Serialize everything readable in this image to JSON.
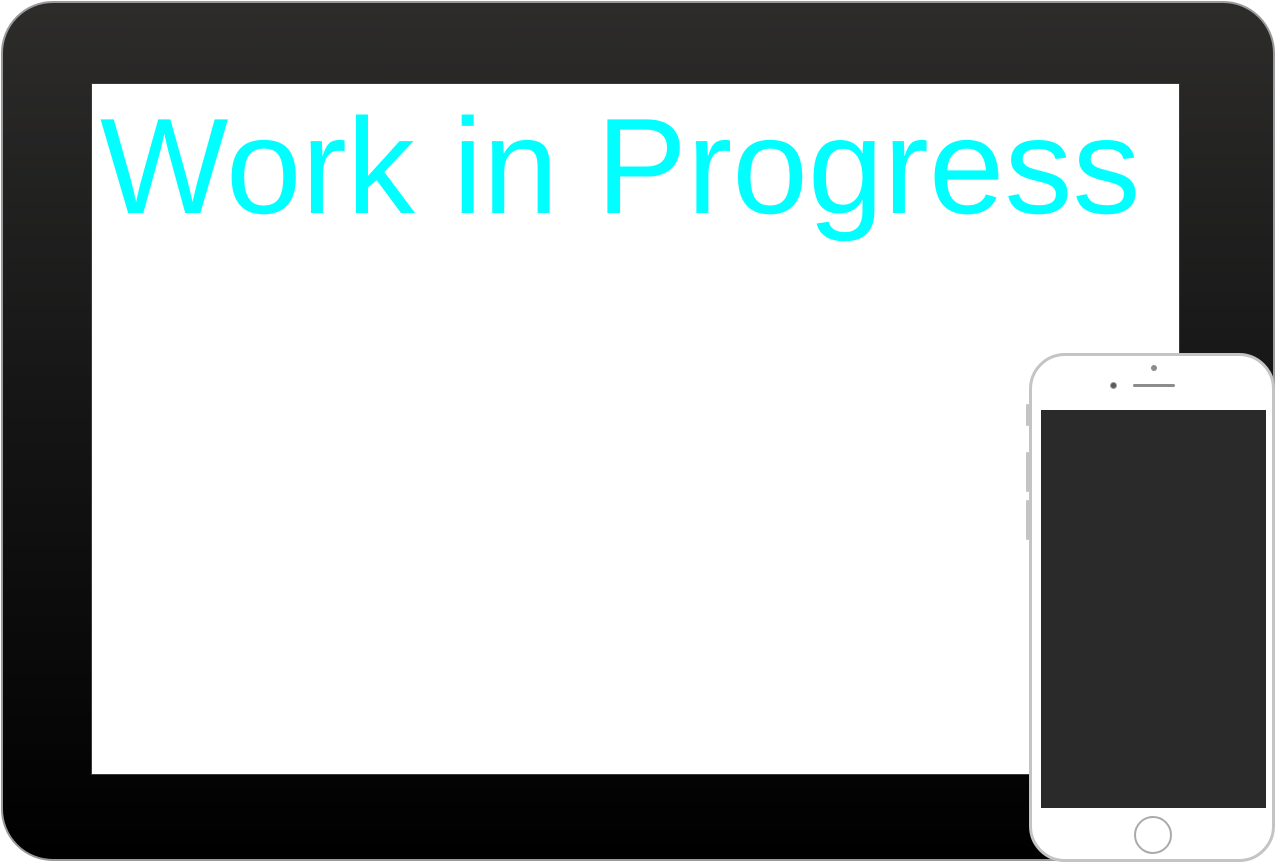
{
  "tablet": {
    "screen": {
      "headline": "Work in Progress",
      "headline_color": "#00ffff"
    },
    "bezel_color": "#1a1a1a"
  },
  "phone": {
    "body_color": "#ffffff",
    "screen_color": "#2a2a2a"
  }
}
